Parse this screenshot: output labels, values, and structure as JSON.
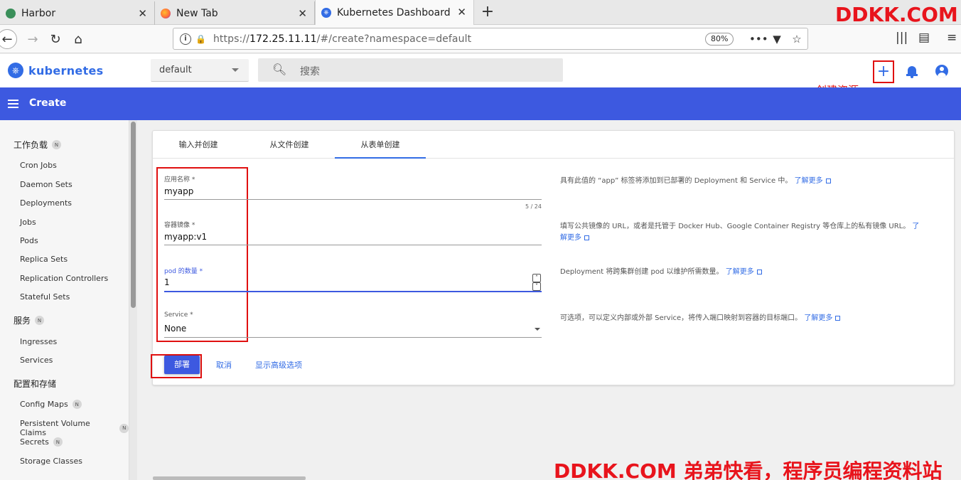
{
  "browser": {
    "tabs": [
      {
        "label": "Harbor",
        "icon": "harbor-icon",
        "active": false
      },
      {
        "label": "New Tab",
        "icon": "firefox-icon",
        "active": false
      },
      {
        "label": "Kubernetes Dashboard",
        "icon": "kubernetes-icon",
        "active": true
      }
    ],
    "url_prefix": "https://",
    "url_host": "172.25.11.11",
    "url_path": "/#/create?namespace=default",
    "zoom": "80%"
  },
  "header": {
    "brand": "kubernetes",
    "namespace": "default",
    "search_placeholder": "搜索",
    "create_annotation": "创建资源"
  },
  "toolbar": {
    "title": "Create"
  },
  "sidebar": {
    "sections": [
      {
        "label": "工作负载",
        "badge": "N",
        "items": [
          "Cron Jobs",
          "Daemon Sets",
          "Deployments",
          "Jobs",
          "Pods",
          "Replica Sets",
          "Replication Controllers",
          "Stateful Sets"
        ]
      },
      {
        "label": "服务",
        "badge": "N",
        "items": [
          "Ingresses",
          "Services"
        ]
      },
      {
        "label": "配置和存储",
        "badge": "",
        "items": [
          "Config Maps",
          "Persistent Volume Claims",
          "Secrets",
          "Storage Classes"
        ]
      }
    ],
    "item_badges": {
      "Config Maps": "N",
      "Persistent Volume Claims": "N",
      "Secrets": "N"
    }
  },
  "main": {
    "tabs": [
      "输入并创建",
      "从文件创建",
      "从表单创建"
    ],
    "active_tab": 2,
    "fields": {
      "app_name": {
        "label": "应用名称 *",
        "value": "myapp",
        "counter": "5 / 24"
      },
      "image": {
        "label": "容器镜像 *",
        "value": "myapp:v1"
      },
      "pods": {
        "label": "pod 的数量 *",
        "value": "1"
      },
      "service": {
        "label": "Service *",
        "value": "None"
      }
    },
    "help": {
      "app_name": "具有此值的 “app” 标签将添加到已部署的 Deployment 和 Service 中。",
      "image": "填写公共镜像的 URL，或者是托管于 Docker Hub、Google Container Registry 等仓库上的私有镜像 URL。",
      "pods": "Deployment 将跨集群创建 pod 以维护所需数量。",
      "service": "可选项，可以定义内部或外部 Service，将传入端口映射到容器的目标端口。",
      "learn_more": "了解更多",
      "learn_more_split_a": "了",
      "learn_more_split_b": "解更多"
    },
    "actions": {
      "deploy": "部署",
      "cancel": "取消",
      "advanced": "显示高级选项"
    }
  },
  "watermark": {
    "top": "DDKK.COM",
    "bottom": "DDKK.COM 弟弟快看，程序员编程资料站"
  },
  "colors": {
    "accent": "#3d59e0",
    "brand": "#326ce5",
    "annotation": "#e01010"
  }
}
